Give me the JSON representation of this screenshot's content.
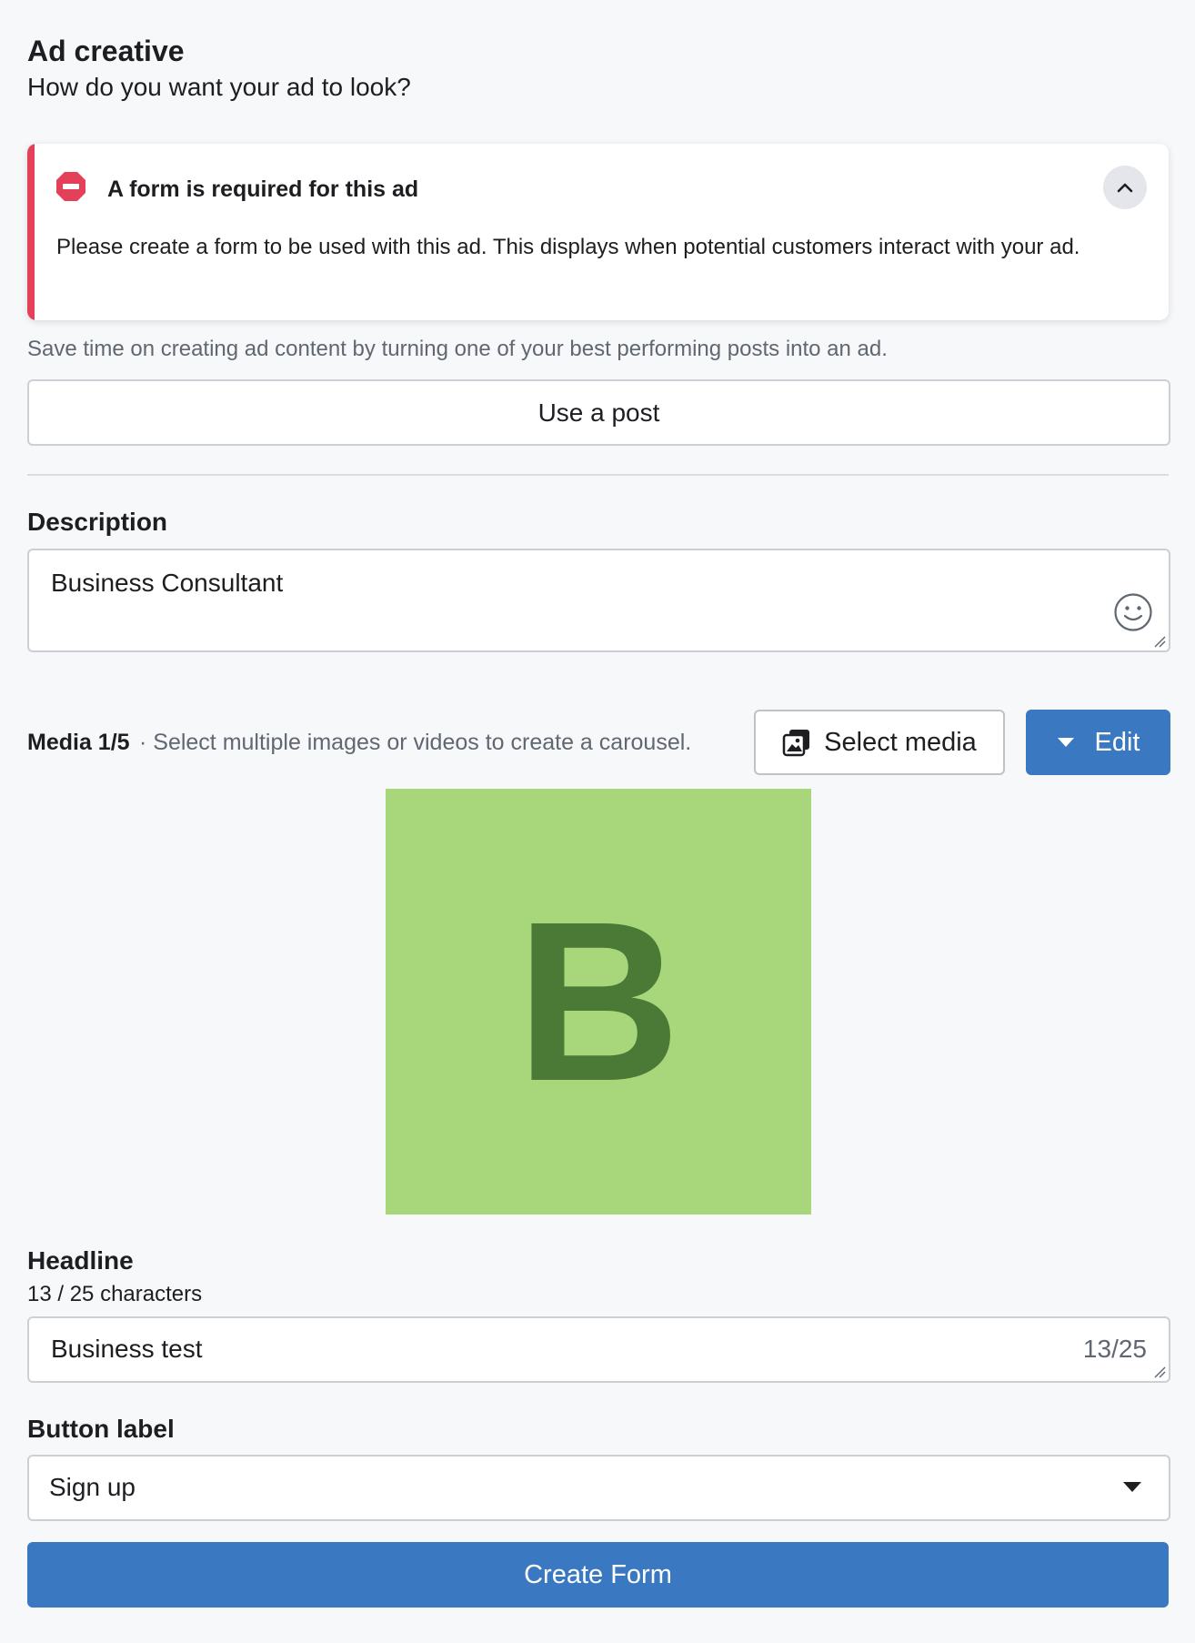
{
  "header": {
    "title": "Ad creative",
    "subtitle": "How do you want your ad to look?"
  },
  "alert": {
    "title": "A form is required for this ad",
    "body": "Please create a form to be used with this ad. This displays when potential customers interact with your ad.",
    "icon": "error-stop-icon",
    "accent_color": "#e4405a"
  },
  "use_post": {
    "hint": "Save time on creating ad content by turning one of your best performing posts into an ad.",
    "button_label": "Use a post"
  },
  "description": {
    "label": "Description",
    "value": "Business Consultant"
  },
  "media": {
    "label": "Media 1/5",
    "hint": "· Select multiple images or videos to create a carousel.",
    "select_label": "Select media",
    "edit_label": "Edit",
    "thumbnail_letter": "B",
    "thumbnail_bg": "#a8d67a",
    "thumbnail_fg": "#4a7a35"
  },
  "headline": {
    "label": "Headline",
    "count_text": "13 / 25 characters",
    "value": "Business test",
    "counter": "13/25"
  },
  "button_label": {
    "label": "Button label",
    "selected": "Sign up"
  },
  "create_form": {
    "label": "Create Form",
    "color": "#3b78c2"
  }
}
